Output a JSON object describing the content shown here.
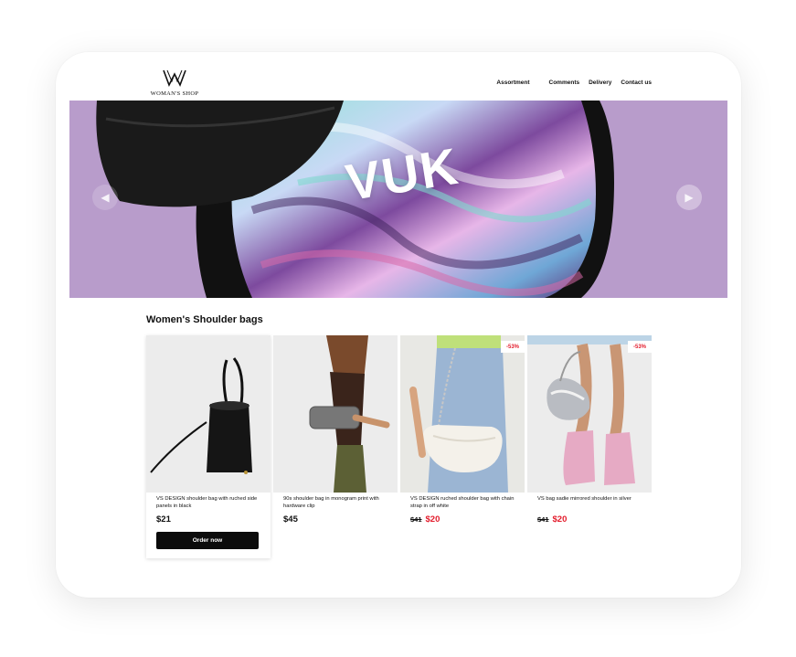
{
  "brand": {
    "logo_text": "WOMAN'S SHOP"
  },
  "nav": {
    "items": [
      "Assortment",
      "Comments",
      "Delivery",
      "Contact us"
    ]
  },
  "hero": {
    "brand_word": "VUK",
    "background": "#b89ccb"
  },
  "section": {
    "title": "Women's Shoulder bags"
  },
  "products": [
    {
      "name": "VS DESIGN shoulder bag with ruched side panels in black",
      "price": "$21",
      "old_price": "",
      "new_price": "",
      "badge": "",
      "cta": "Order now"
    },
    {
      "name": "90s shoulder bag in monogram print with hardware clip",
      "price": "$45",
      "old_price": "",
      "new_price": "",
      "badge": ""
    },
    {
      "name": "VS DESIGN ruched shoulder bag with chain strap in off white",
      "price": "",
      "old_price": "$41",
      "new_price": "$20",
      "badge": "-53%"
    },
    {
      "name": "VS bag sadie mirrored shoulder in silver",
      "price": "",
      "old_price": "$41",
      "new_price": "$20",
      "badge": "-53%"
    }
  ],
  "colors": {
    "accent_red": "#e31b2b",
    "button": "#0b0b0b"
  },
  "icons": {
    "prev": "chevron-left-icon",
    "next": "chevron-right-icon"
  }
}
